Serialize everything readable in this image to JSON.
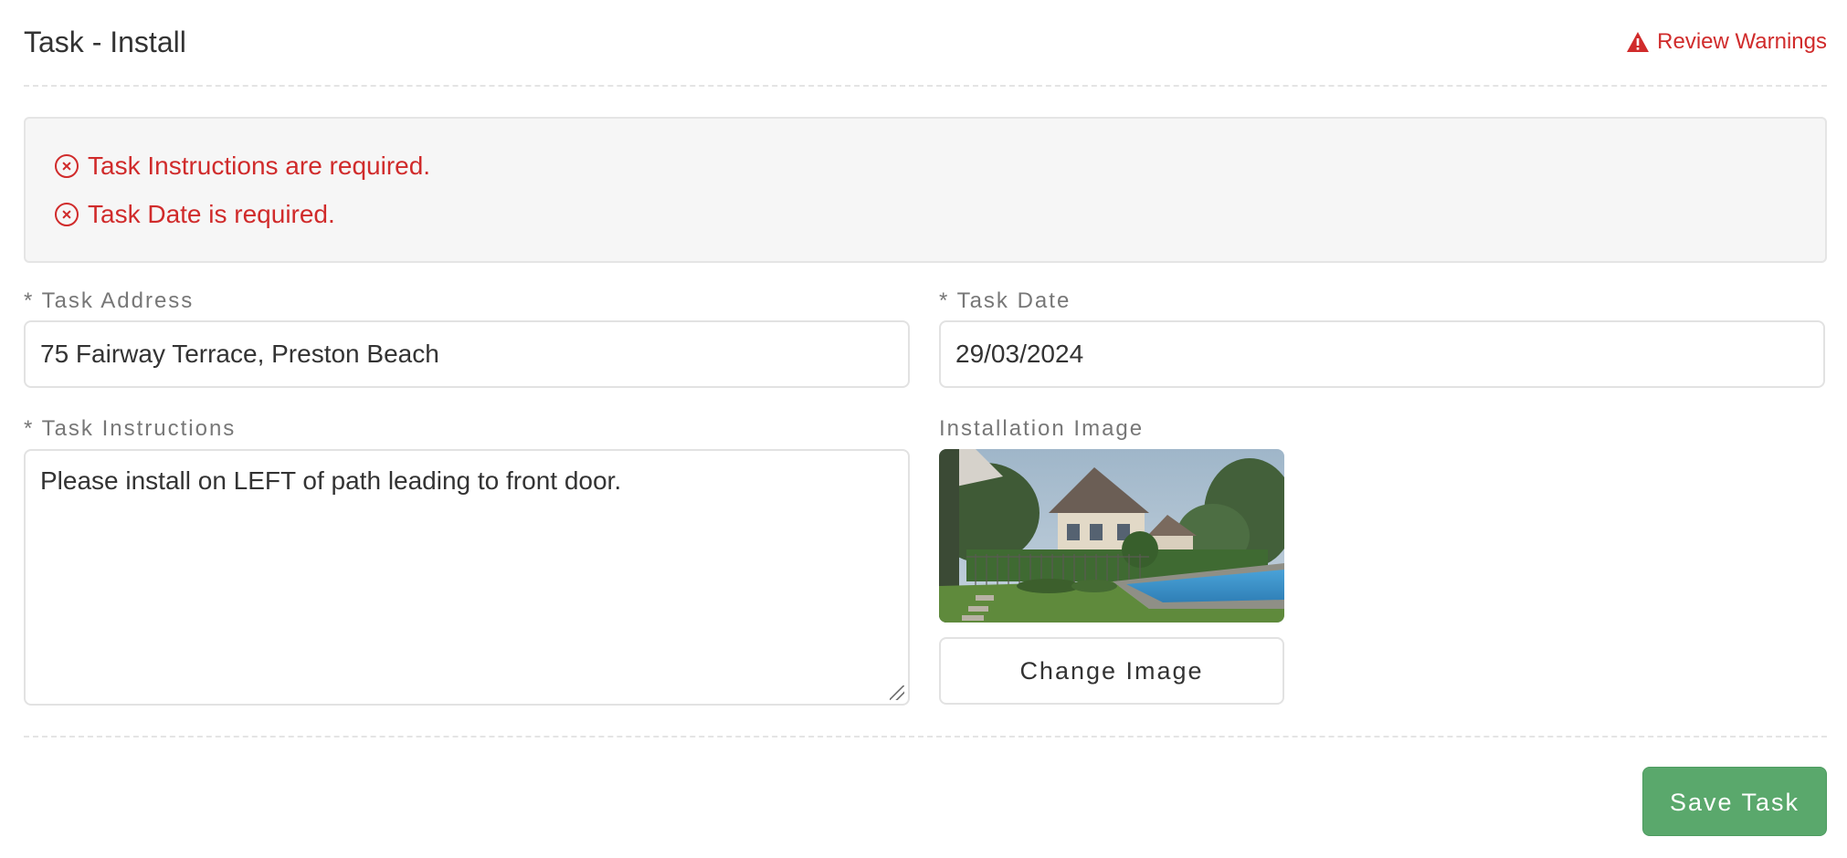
{
  "header": {
    "title": "Task - Install",
    "review_warnings": "Review Warnings"
  },
  "errors": [
    {
      "text": "Task Instructions are required."
    },
    {
      "text": "Task Date is required."
    }
  ],
  "form": {
    "address": {
      "label": "* Task Address",
      "value": "75 Fairway Terrace, Preston Beach"
    },
    "date": {
      "label": "* Task Date",
      "value": "29/03/2024"
    },
    "instructions": {
      "label": "* Task Instructions",
      "value": "Please install on LEFT of path leading to front door."
    },
    "image": {
      "label": "Installation Image",
      "change_label": "Change Image"
    }
  },
  "footer": {
    "save_label": "Save Task"
  },
  "colors": {
    "error": "#d02b2b",
    "save": "#5aa86c"
  }
}
